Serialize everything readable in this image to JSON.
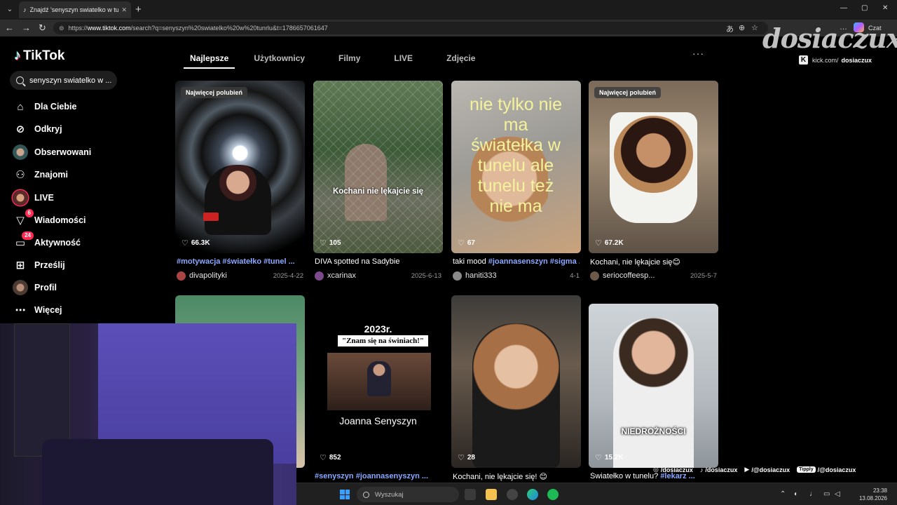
{
  "browser": {
    "tab_title": "Znajdź 'senyszyn swiatelko w tuneli",
    "url_prefix": "https://",
    "url_host": "www.tiktok.com",
    "url_rest": "/search?q=senyszyn%20swiatelko%20w%20tunrlu&t=1786657061647",
    "copilot_label": "Czat"
  },
  "watermark": {
    "text": "dosiaczux",
    "kick_handle_pre": "kick.com/",
    "kick_handle": "dosiaczux"
  },
  "tiktok": {
    "logo": "TikTok",
    "search_value": "senyszyn swiatelko w ...",
    "nav": [
      {
        "label": "Dla Ciebie",
        "icon": "home-icon"
      },
      {
        "label": "Odkryj",
        "icon": "compass-icon"
      },
      {
        "label": "Obserwowani",
        "icon": "following-avatar-icon"
      },
      {
        "label": "Znajomi",
        "icon": "friends-icon"
      },
      {
        "label": "LIVE",
        "icon": "live-icon"
      },
      {
        "label": "Wiadomości",
        "icon": "messages-icon",
        "badge": "6"
      },
      {
        "label": "Aktywność",
        "icon": "activity-icon",
        "badge": "24"
      },
      {
        "label": "Prześlij",
        "icon": "upload-icon"
      },
      {
        "label": "Profil",
        "icon": "profile-avatar-icon"
      },
      {
        "label": "Więcej",
        "icon": "more-icon"
      }
    ],
    "tabs": [
      "Najlepsze",
      "Użytkownicy",
      "Filmy",
      "LIVE",
      "Zdjęcie"
    ],
    "active_tab": "Najlepsze",
    "videos": [
      {
        "pill": "Najwięcej polubień",
        "likes": "66.3K",
        "tags": "#motywacja #światełko #tunel ...",
        "desc": "",
        "author": "divapolityki",
        "date": "2025-4-22"
      },
      {
        "pill": "",
        "likes": "105",
        "overlay": "Kochani nie lękajcie się",
        "tags": "",
        "desc": "DIVA spotted na Sadybie",
        "author": "xcarinax",
        "date": "2025-6-13"
      },
      {
        "pill": "",
        "likes": "67",
        "overlay": "nie tylko nie ma światełka w tunelu ale tunelu też nie ma",
        "desc": "taki mood ",
        "tags": "#joannasenszyn #sigma ...",
        "author": "haniti333",
        "date": "4-1"
      },
      {
        "pill": "Najwięcej polubień",
        "likes": "67.2K",
        "tags": "",
        "desc": "Kochani, nie lękajcie się😊",
        "author": "seriocoffeesp...",
        "date": "2025-5-7"
      },
      {
        "pill": "",
        "likes": "",
        "tags": "",
        "desc": "",
        "author": "",
        "date": ""
      },
      {
        "pill": "",
        "likes": "852",
        "overlay_year": "2023r.",
        "overlay_quote": "\"Znam się na świniach!\"",
        "overlay_name": "Joanna Senyszyn",
        "tags": "#senyszyn #joannasenyszyn ...",
        "desc": "",
        "author": "",
        "date": ""
      },
      {
        "pill": "",
        "likes": "28",
        "tags": "",
        "desc": "Kochani, nie lękajcie się! 😊",
        "author": "",
        "date": ""
      },
      {
        "pill": "",
        "likes": "15.2K",
        "overlay": "NIEDROŻNOŚCI",
        "desc": "Światełko w tunelu? ",
        "tags": "#lekarz ...",
        "author": "",
        "date": ""
      }
    ]
  },
  "socials": [
    {
      "icon": "instagram-icon",
      "handle": "/dosiaczux"
    },
    {
      "icon": "tiktok-icon",
      "handle": "/dosiaczux"
    },
    {
      "icon": "youtube-icon",
      "handle": "/@dosiaczux"
    },
    {
      "icon": "tipply-icon",
      "badge": "Tipply",
      "handle": "/@dosiaczux"
    }
  ],
  "taskbar": {
    "search_placeholder": "Wyszukaj",
    "time": "23:38",
    "date": "13.08.2026"
  }
}
